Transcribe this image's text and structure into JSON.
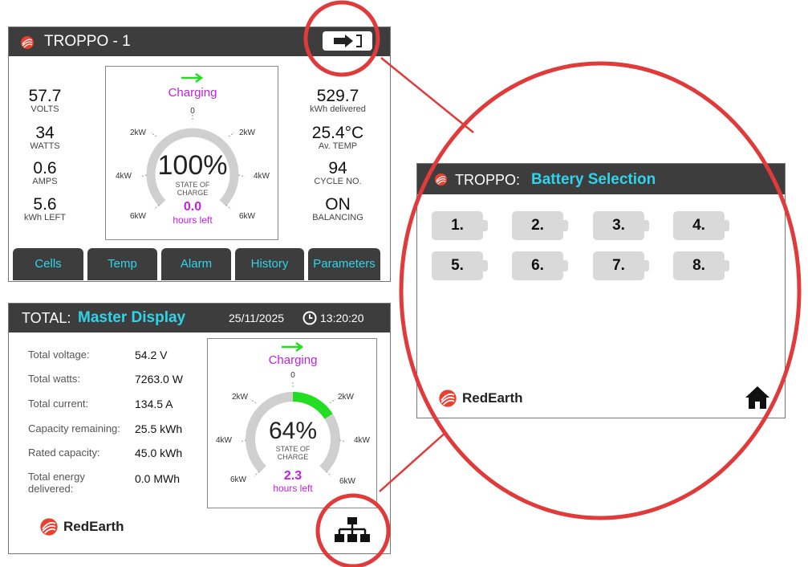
{
  "colors": {
    "accent": "#2fd4ea",
    "charging": "#c020e0",
    "arrow": "#22dd22",
    "callout": "#e03a3a",
    "titlebar": "#3d3d3d"
  },
  "battery_screen": {
    "title": "TROPPO - 1",
    "logout_icon": "logout-arrow-icon",
    "status": "Charging",
    "left": [
      {
        "value": "57.7",
        "label": "VOLTS"
      },
      {
        "value": "34",
        "label": "WATTS"
      },
      {
        "value": "0.6",
        "label": "AMPS"
      },
      {
        "value": "5.6",
        "label": "kWh LEFT"
      }
    ],
    "right": [
      {
        "value": "529.7",
        "label": "kWh delivered"
      },
      {
        "value": "25.4°C",
        "label": "Av. TEMP"
      },
      {
        "value": "94",
        "label": "CYCLE NO."
      },
      {
        "value": "ON",
        "label": "BALANCING"
      }
    ],
    "gauge": {
      "percent_text": "100%",
      "label1": "STATE OF",
      "label2": "CHARGE",
      "hours_value": "0.0",
      "hours_label": "hours left",
      "charge_fraction": 1.0,
      "ticks": {
        "top": "0",
        "upper_left": "2kW",
        "upper_right": "2kW",
        "mid_left": "4kW",
        "mid_right": "4kW",
        "low_left": "6kW",
        "low_right": "6kW"
      }
    },
    "tabs": [
      "Cells",
      "Temp",
      "Alarm",
      "History",
      "Parameters"
    ]
  },
  "master_screen": {
    "title_prefix": "TOTAL:",
    "title_main": "Master Display",
    "date": "25/11/2025",
    "time": "13:20:20",
    "rows": [
      {
        "label": "Total voltage:",
        "value": "54.2 V"
      },
      {
        "label": "Total watts:",
        "value": "7263.0 W"
      },
      {
        "label": "Total current:",
        "value": "134.5 A"
      },
      {
        "label": "Capacity remaining:",
        "value": "25.5 kWh"
      },
      {
        "label": "Rated capacity:",
        "value": "45.0 kWh"
      },
      {
        "label": "Total energy delivered:",
        "value": "0.0 MWh"
      }
    ],
    "status": "Charging",
    "gauge": {
      "percent_text": "64%",
      "label1": "STATE OF",
      "label2": "CHARGE",
      "hours_value": "2.3",
      "hours_label": "hours left",
      "charge_fraction": 0.64,
      "ticks": {
        "top": "0",
        "upper_left": "2kW",
        "upper_right": "2kW",
        "mid_left": "4kW",
        "mid_right": "4kW",
        "low_left": "6kW",
        "low_right": "6kW"
      }
    },
    "brand": "RedEarth"
  },
  "selection_screen": {
    "title_prefix": "TROPPO:",
    "title_main": "Battery Selection",
    "batteries": [
      "1.",
      "2.",
      "3.",
      "4.",
      "5.",
      "6.",
      "7.",
      "8."
    ],
    "brand": "RedEarth"
  }
}
